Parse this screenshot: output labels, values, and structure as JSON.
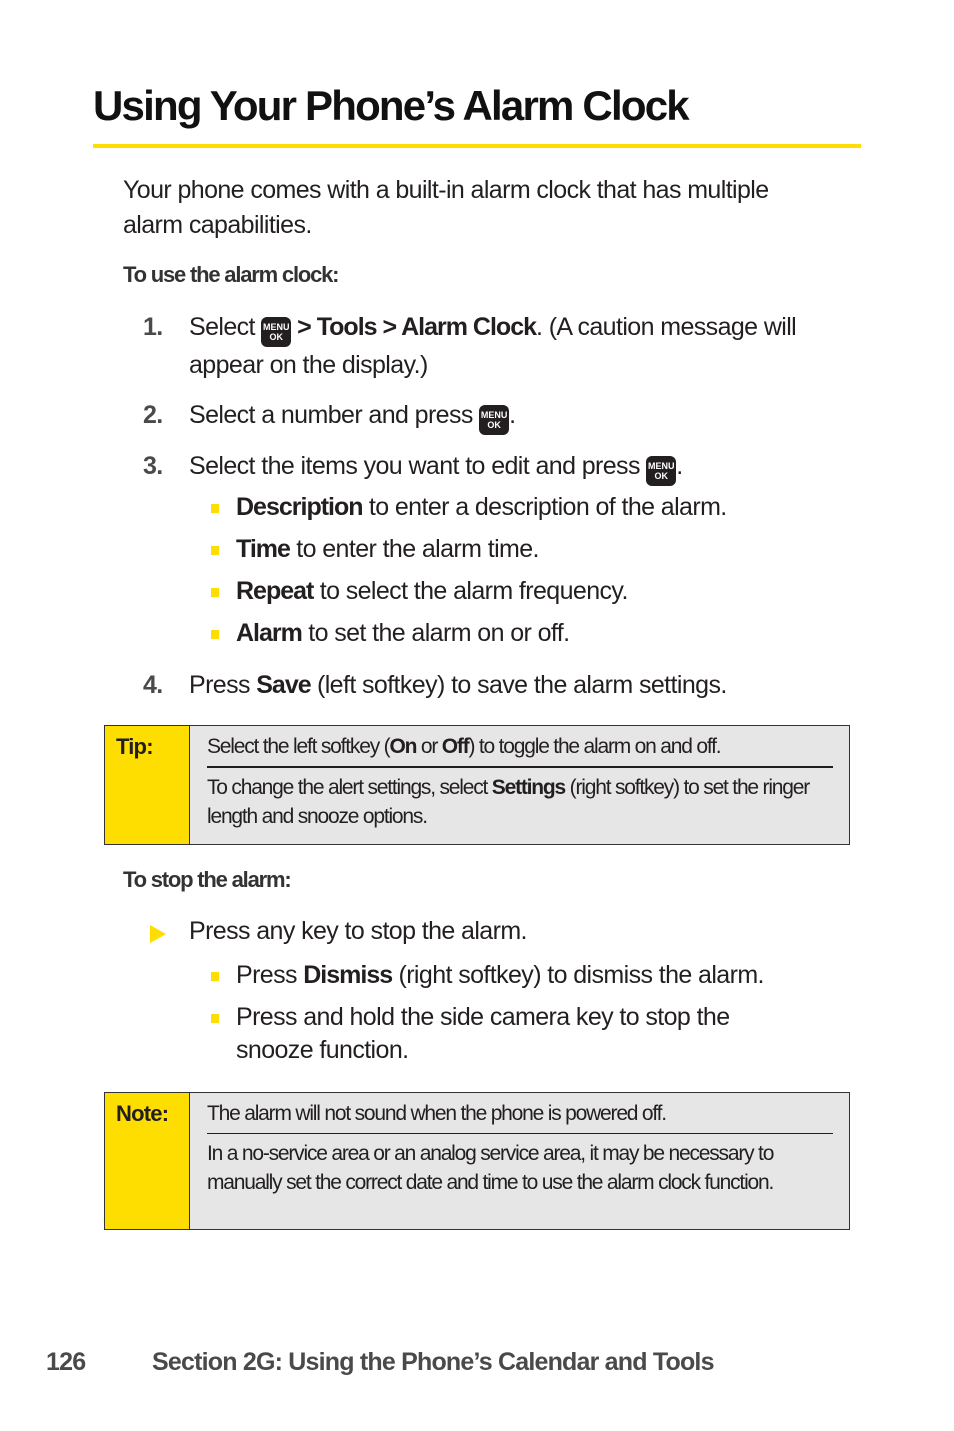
{
  "page": {
    "title": "Using Your Phone’s Alarm Clock",
    "intro": "Your phone comes with a built-in alarm clock that has multiple alarm capabilities.",
    "use_heading": "To use the alarm clock:",
    "menu_key": {
      "line1": "MENU",
      "line2": "OK",
      "icon": "menu-ok-key-icon"
    },
    "steps": [
      {
        "num": "1.",
        "pre": "Select ",
        "sep1": " > ",
        "b1": "Tools",
        "sep2": " > ",
        "b2": "Alarm Clock",
        "post": ". (A caution message will appear on the display.)"
      },
      {
        "num": "2.",
        "pre": "Select a number and press ",
        "post": "."
      },
      {
        "num": "3.",
        "pre": "Select the items you want to edit and press ",
        "post": "."
      },
      {
        "num": "4.",
        "pre": "Press ",
        "bold": "Save",
        "post": " (left softkey) to save the alarm settings."
      }
    ],
    "step3_bullets": [
      {
        "bold": "Description",
        "text": " to enter a description of the alarm."
      },
      {
        "bold": "Time",
        "text": " to enter the alarm time."
      },
      {
        "bold": "Repeat",
        "text": " to select the alarm frequency."
      },
      {
        "bold": "Alarm",
        "text": " to set the alarm on or off."
      }
    ],
    "tip": {
      "label": "Tip:",
      "p1": {
        "pre": "Select the left softkey (",
        "b1": "On",
        "mid": " or ",
        "b2": "Off",
        "post": ") to toggle the alarm on and off."
      },
      "p2": {
        "pre": "To change the alert settings, select ",
        "bold": "Settings",
        "post": " (right softkey) to set the ringer length and snooze options."
      }
    },
    "stop_heading": "To stop the alarm:",
    "stop_item": "Press any key to stop the alarm.",
    "stop_bullets": [
      {
        "pre": "Press ",
        "bold": "Dismiss",
        "text": " (right softkey) to dismiss the alarm."
      },
      {
        "pre": "",
        "bold": "",
        "text": "Press and hold the side camera key to stop the snooze function."
      }
    ],
    "note": {
      "label": "Note:",
      "p1": "The alarm will not sound when the phone is powered off.",
      "p2": "In a no-service area or an analog service area, it may be necessary to manually set the correct date and time to use the alarm clock function."
    },
    "footer": {
      "page_number": "126",
      "section": "Section 2G: Using the Phone’s Calendar and Tools"
    },
    "colors": {
      "accent": "#fedd00",
      "box_bg": "#e6e6e6",
      "text": "#231f20"
    }
  }
}
